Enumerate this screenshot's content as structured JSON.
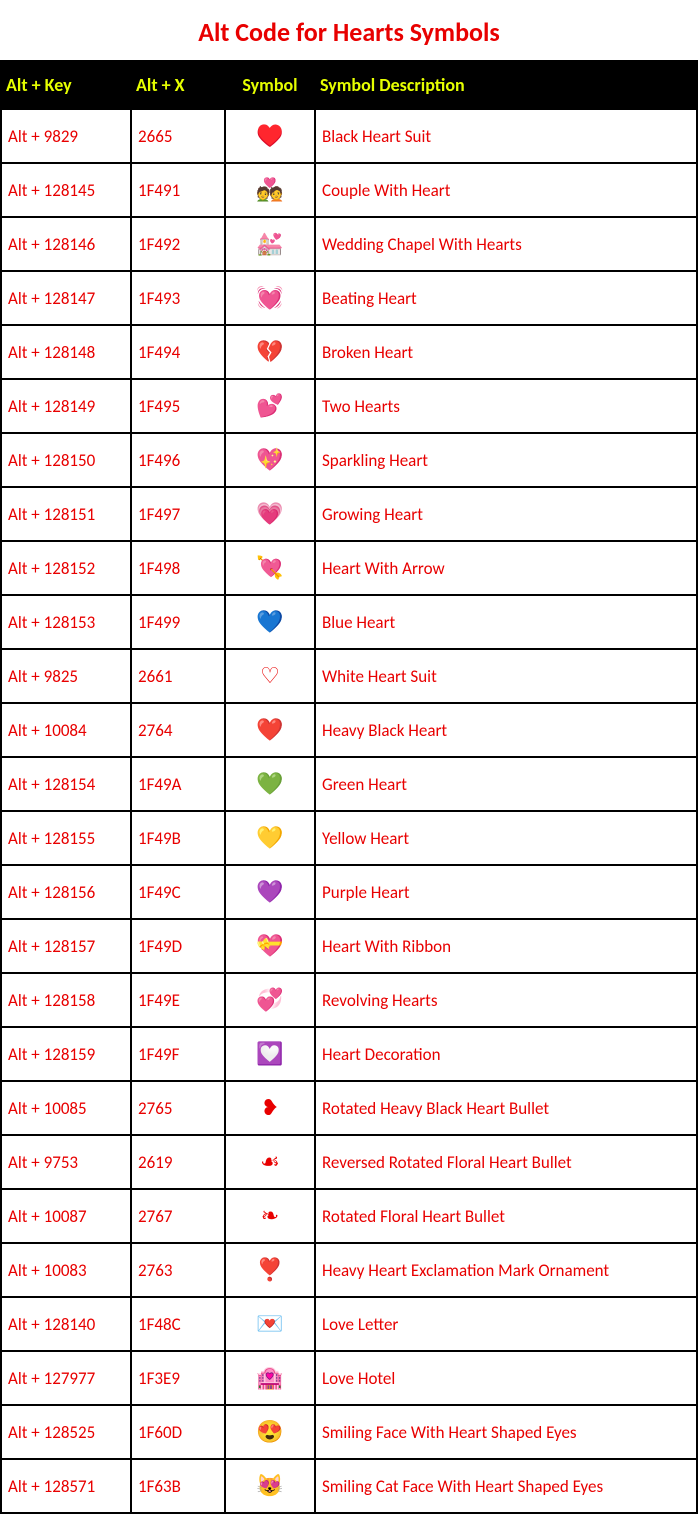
{
  "title": "Alt Code for Hearts Symbols",
  "headers": {
    "alt_key": "Alt + Key",
    "alt_x": "Alt + X",
    "symbol": "Symbol",
    "description": "Symbol Description"
  },
  "rows": [
    {
      "alt_key": "Alt + 9829",
      "alt_x": "2665",
      "symbol": "♥",
      "description": "Black Heart Suit"
    },
    {
      "alt_key": "Alt + 128145",
      "alt_x": "1F491",
      "symbol": "💑",
      "description": "Couple With Heart"
    },
    {
      "alt_key": "Alt + 128146",
      "alt_x": "1F492",
      "symbol": "💒",
      "description": "Wedding Chapel With Hearts"
    },
    {
      "alt_key": "Alt + 128147",
      "alt_x": "1F493",
      "symbol": "💓",
      "description": "Beating Heart"
    },
    {
      "alt_key": "Alt + 128148",
      "alt_x": "1F494",
      "symbol": "💔",
      "description": "Broken Heart"
    },
    {
      "alt_key": "Alt + 128149",
      "alt_x": "1F495",
      "symbol": "💕",
      "description": "Two Hearts"
    },
    {
      "alt_key": "Alt + 128150",
      "alt_x": "1F496",
      "symbol": "💖",
      "description": "Sparkling Heart"
    },
    {
      "alt_key": "Alt + 128151",
      "alt_x": "1F497",
      "symbol": "💗",
      "description": "Growing Heart"
    },
    {
      "alt_key": "Alt + 128152",
      "alt_x": "1F498",
      "symbol": "💘",
      "description": "Heart With Arrow"
    },
    {
      "alt_key": "Alt + 128153",
      "alt_x": "1F499",
      "symbol": "💙",
      "description": "Blue Heart"
    },
    {
      "alt_key": "Alt + 9825",
      "alt_x": "2661",
      "symbol": "♡",
      "description": "White Heart Suit"
    },
    {
      "alt_key": "Alt + 10084",
      "alt_x": "2764",
      "symbol": "❤",
      "description": "Heavy Black Heart"
    },
    {
      "alt_key": "Alt + 128154",
      "alt_x": "1F49A",
      "symbol": "💚",
      "description": "Green Heart"
    },
    {
      "alt_key": "Alt + 128155",
      "alt_x": "1F49B",
      "symbol": "💛",
      "description": "Yellow Heart"
    },
    {
      "alt_key": "Alt + 128156",
      "alt_x": "1F49C",
      "symbol": "💜",
      "description": "Purple Heart"
    },
    {
      "alt_key": "Alt + 128157",
      "alt_x": "1F49D",
      "symbol": "💝",
      "description": "Heart With Ribbon"
    },
    {
      "alt_key": "Alt + 128158",
      "alt_x": "1F49E",
      "symbol": "💞",
      "description": "Revolving Hearts"
    },
    {
      "alt_key": "Alt + 128159",
      "alt_x": "1F49F",
      "symbol": "💟",
      "description": "Heart Decoration"
    },
    {
      "alt_key": "Alt + 10085",
      "alt_x": "2765",
      "symbol": "❥",
      "description": "Rotated Heavy Black Heart Bullet"
    },
    {
      "alt_key": "Alt + 9753",
      "alt_x": "2619",
      "symbol": "☙",
      "description": "Reversed Rotated Floral Heart Bullet"
    },
    {
      "alt_key": "Alt + 10087",
      "alt_x": "2767",
      "symbol": "❧",
      "description": "Rotated Floral Heart Bullet"
    },
    {
      "alt_key": "Alt + 10083",
      "alt_x": "2763",
      "symbol": "❣",
      "description": "Heavy Heart Exclamation Mark Ornament"
    },
    {
      "alt_key": "Alt + 128140",
      "alt_x": "1F48C",
      "symbol": "💌",
      "description": "Love Letter"
    },
    {
      "alt_key": "Alt + 127977",
      "alt_x": "1F3E9",
      "symbol": "🏩",
      "description": "Love Hotel"
    },
    {
      "alt_key": "Alt + 128525",
      "alt_x": "1F60D",
      "symbol": "😍",
      "description": "Smiling Face With Heart Shaped Eyes"
    },
    {
      "alt_key": "Alt + 128571",
      "alt_x": "1F63B",
      "symbol": "😻",
      "description": "Smiling Cat Face With Heart Shaped Eyes"
    }
  ]
}
